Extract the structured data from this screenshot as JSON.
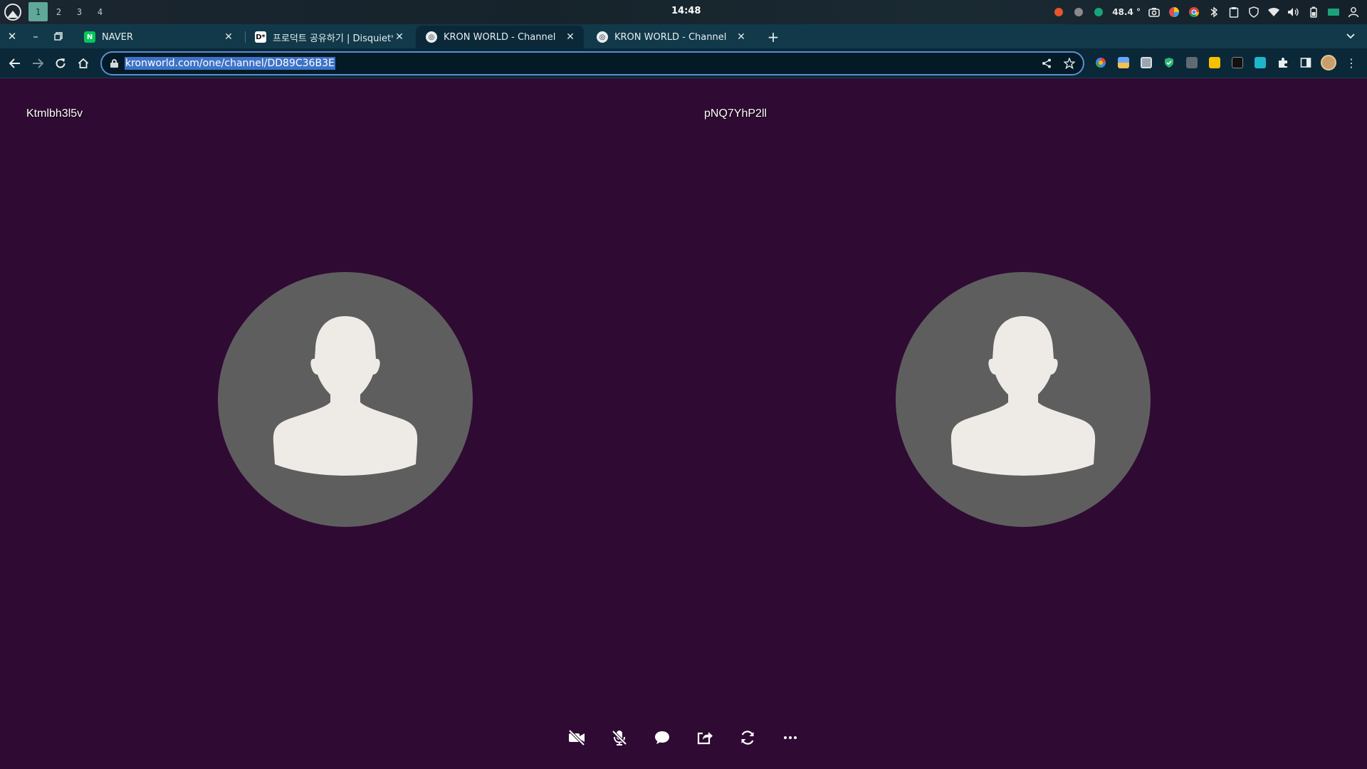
{
  "os": {
    "workspaces": [
      "1",
      "2",
      "3",
      "4"
    ],
    "active_workspace": "1",
    "clock": "14:48",
    "temperature": "48.4 °",
    "tray_icons": [
      "firefox-icon",
      "grey-dot-icon",
      "green-dot-icon",
      "screenshot-icon",
      "color-picker-icon",
      "chrome-icon",
      "bluetooth-icon",
      "clipboard-icon",
      "shield-icon",
      "wifi-icon",
      "volume-icon",
      "battery-icon",
      "storage-icon",
      "user-icon"
    ]
  },
  "browser": {
    "tabs": [
      {
        "title": "NAVER",
        "favicon": "N",
        "favicon_color": "#03c75a",
        "active": false
      },
      {
        "title": "프로덕트 공유하기 | Disquiet*",
        "favicon": "D*",
        "favicon_color": "#ffffff",
        "active": false
      },
      {
        "title": "KRON WORLD - Channel",
        "favicon": "◎",
        "favicon_color": "#1b1b1b",
        "active": true
      },
      {
        "title": "KRON WORLD - Channel",
        "favicon": "◎",
        "favicon_color": "#1b1b1b",
        "active": false
      }
    ],
    "url": "kronworld.com/one/channel/DD89C36B3E",
    "accent_color": "#5b8fd0"
  },
  "call": {
    "background_color": "#2f0a33",
    "participants": [
      {
        "name": "Ktmlbh3l5v"
      },
      {
        "name": "pNQ7YhP2ll"
      }
    ],
    "controls": [
      "camera-off-icon",
      "mic-off-icon",
      "chat-icon",
      "share-icon",
      "refresh-icon",
      "more-icon"
    ]
  }
}
